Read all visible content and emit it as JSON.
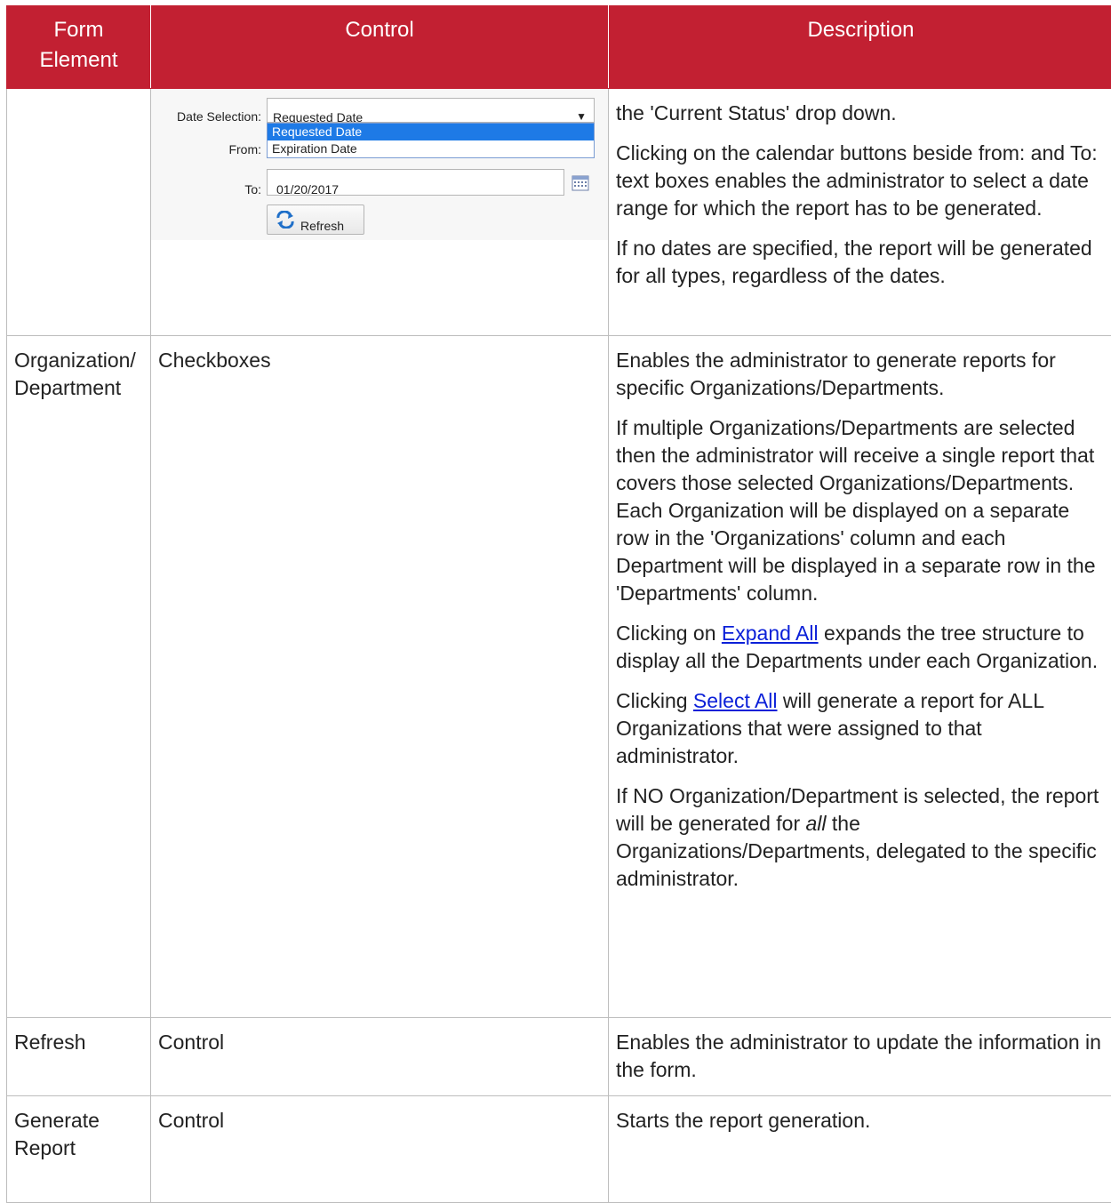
{
  "header": {
    "col1": "Form Element",
    "col2": "Control",
    "col3": "Description"
  },
  "form_shot": {
    "date_selection_label": "Date Selection:",
    "date_selection_value": "Requested Date",
    "options": [
      "Requested Date",
      "Expiration Date"
    ],
    "from_label": "From:",
    "to_label": "To:",
    "to_value": "01/20/2017",
    "refresh_label": "Refresh"
  },
  "row_dates": {
    "desc": [
      "the 'Current Status' drop down.",
      "Clicking on the calendar buttons beside from: and To: text boxes enables the administrator to select a date range for which the report has to be generated.",
      "If no dates are specified, the report will be generated for all types, regardless of the dates."
    ]
  },
  "row_org": {
    "element": "Organization/ Department",
    "control": "Checkboxes",
    "p1": "Enables the administrator to generate reports for specific Organizations/Departments.",
    "p2": "If multiple Organizations/Departments are selected then the administrator will receive a single report that covers those selected Organizations/Departments. Each Organization will be displayed on a separate row in the 'Organizations' column and each Department will be displayed in a separate row in the 'Departments' column.",
    "p3_pre": "Clicking on ",
    "p3_link": "Expand All",
    "p3_post": " expands the tree structure to display all the Departments under each Organization.",
    "p4_pre": "Clicking ",
    "p4_link": "Select All",
    "p4_post": " will generate a report for ALL Organizations that were assigned to that administrator.",
    "p5_pre": "If NO Organization/Department is selected, the report will be generated for ",
    "p5_em": "all",
    "p5_post": " the Organizations/Departments, delegated to the specific administrator."
  },
  "row_refresh": {
    "element": "Refresh",
    "control": "Control",
    "desc": "Enables the administrator to update the information in the form."
  },
  "row_generate": {
    "element": "Generate Report",
    "control": "Control",
    "desc": "Starts the report generation."
  }
}
